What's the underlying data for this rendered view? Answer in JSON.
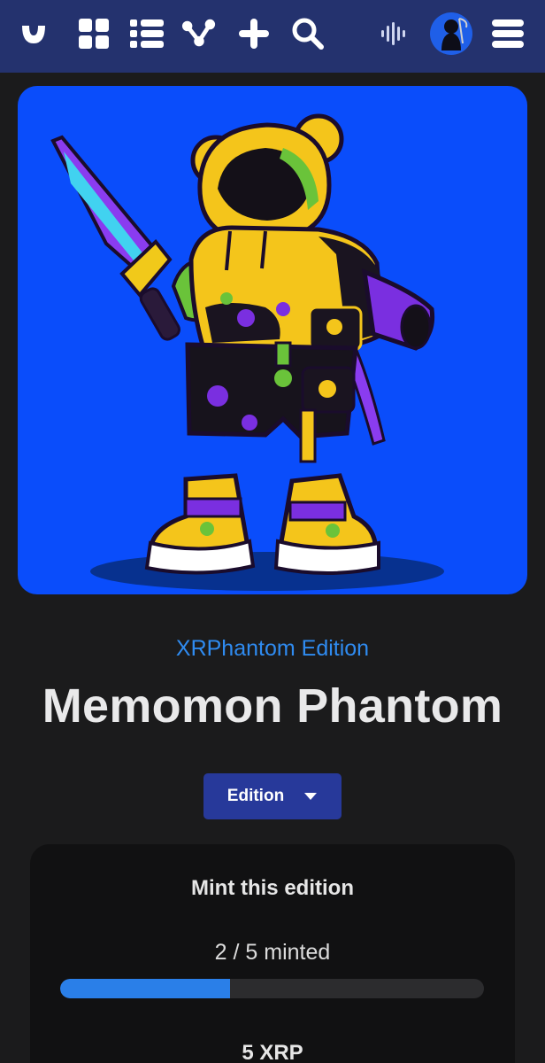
{
  "topbar": {
    "background": "#24326e",
    "icons": [
      "logo-icon",
      "grid-icon",
      "list-icon",
      "activity-icon",
      "plus-icon",
      "search-icon",
      "audio-wave-icon",
      "avatar",
      "menu-icon"
    ]
  },
  "artwork": {
    "background": "#0a4dfb",
    "subject": "Memomon Phantom character"
  },
  "collection_name": "XRPhantom Edition",
  "title": "Memomon Phantom",
  "edition_select": {
    "label": "Edition"
  },
  "mint": {
    "heading": "Mint this edition",
    "count_text": "2 / 5 minted",
    "minted": 2,
    "supply": 5,
    "progress_fraction": 0.4,
    "price": "5 XRP"
  },
  "colors": {
    "accent": "#2f8bf0",
    "progress": "#2a7fe8",
    "button": "#27399a",
    "page_bg": "#1b1b1c"
  }
}
